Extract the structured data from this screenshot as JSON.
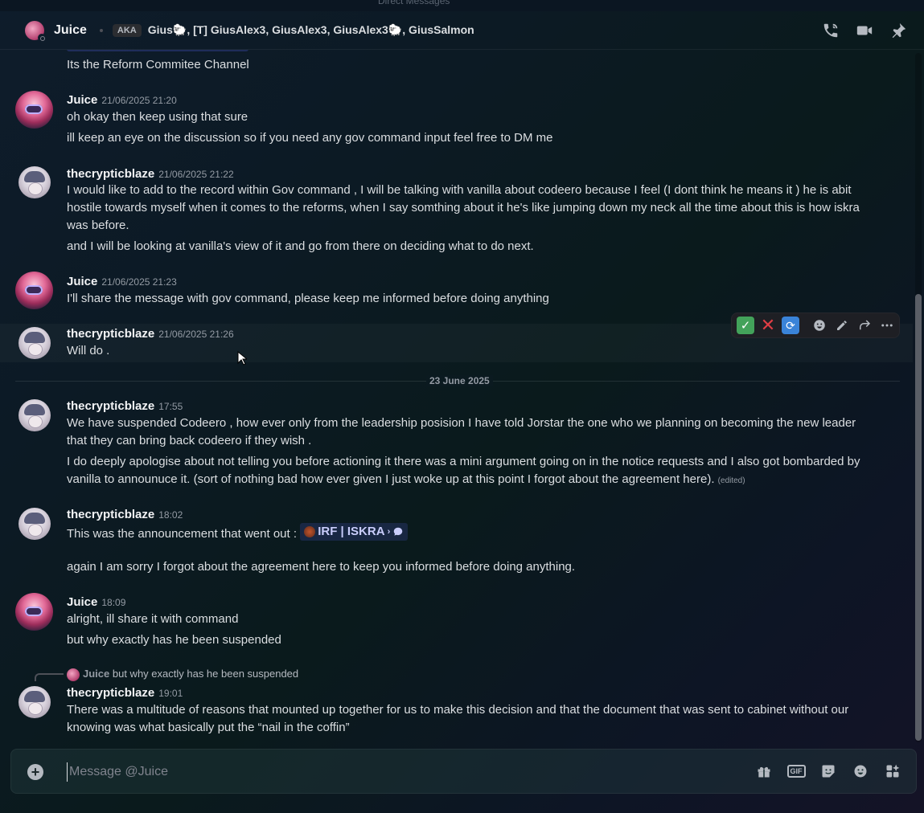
{
  "window_title": "Direct Messages",
  "header": {
    "name": "Juice",
    "aka_label": "AKA",
    "aliases": "Gius🐑, [T] GiusAlex3, GiusAlex3, GiusAlex3🐑, GiusSalmon"
  },
  "icons": {
    "call": "phone-call-icon",
    "video": "video-camera-icon",
    "pin": "pin-icon"
  },
  "messages": [
    {
      "id": "m0",
      "lines": [
        "Its the Reform Commitee Channel"
      ]
    },
    {
      "id": "m1",
      "author": "Juice",
      "timestamp": "21/06/2025 21:20",
      "lines": [
        "oh okay then keep using that sure",
        "ill keep an eye on the discussion so if you need any gov command input feel free to DM me"
      ]
    },
    {
      "id": "m2",
      "author": "thecrypticblaze",
      "timestamp": "21/06/2025 21:22",
      "lines": [
        "I would like to add to the record within Gov command , I will be talking with vanilla about codeero because I feel (I dont think he means it ) he is abit hostile towards myself when it comes to the reforms, when I say somthing about it he's like jumping down my neck all the time about this is how iskra was before.",
        "and I will be looking at vanilla's view of it and go from there on deciding what to do next."
      ]
    },
    {
      "id": "m3",
      "author": "Juice",
      "timestamp": "21/06/2025 21:23",
      "lines": [
        "I'll share the message with gov command, please keep me informed before doing anything"
      ]
    },
    {
      "id": "m4",
      "author": "thecrypticblaze",
      "timestamp": "21/06/2025 21:26",
      "lines": [
        "Will do ."
      ]
    },
    {
      "id": "m5",
      "author": "thecrypticblaze",
      "timestamp": "17:55",
      "lines": [
        "We have suspended Codeero , how ever only from the leadership posision I have told Jorstar the one who we planning on becoming the new leader that they can bring back codeero if they wish .",
        "I do deeply apologise about not telling you before actioning it there was a mini argument going on in the notice requests and I also got bombarded by vanilla to announuce it. (sort of nothing bad how ever given I just woke up at this point I forgot about the agreement here)."
      ],
      "edited": "(edited)"
    },
    {
      "id": "m6",
      "author": "thecrypticblaze",
      "timestamp": "18:02",
      "lines": [
        "This was the announcement that went out :",
        "again I am sorry I forgot about the agreement here to keep you informed before doing anything."
      ],
      "mention": "IRF | ISKRA",
      "mention_sep": "›"
    },
    {
      "id": "m7",
      "author": "Juice",
      "timestamp": "18:09",
      "lines": [
        "alright, ill share it with command",
        "but why exactly has he been suspended"
      ]
    },
    {
      "id": "m8",
      "author": "thecrypticblaze",
      "timestamp": "19:01",
      "reply_to": {
        "author": "Juice",
        "text": "but why exactly has he been suspended"
      },
      "lines": [
        "There was a multitude of reasons that mounted up together for us to make this decision and that the document that was sent to cabinet without our knowing was what basically put the “nail in the coffin”"
      ]
    }
  ],
  "date_divider": "23 June 2025",
  "hover_toolbar": {
    "reactions": [
      "white-check-mark",
      "cross-mark",
      "repeat-button"
    ],
    "actions": [
      "add-reaction-icon",
      "edit-icon",
      "forward-icon",
      "more-icon"
    ]
  },
  "composer": {
    "placeholder": "Message @Juice",
    "value": "",
    "gif_label": "GIF",
    "icons": [
      "gift-icon",
      "gif-icon",
      "sticker-icon",
      "emoji-icon",
      "apps-icon"
    ]
  }
}
